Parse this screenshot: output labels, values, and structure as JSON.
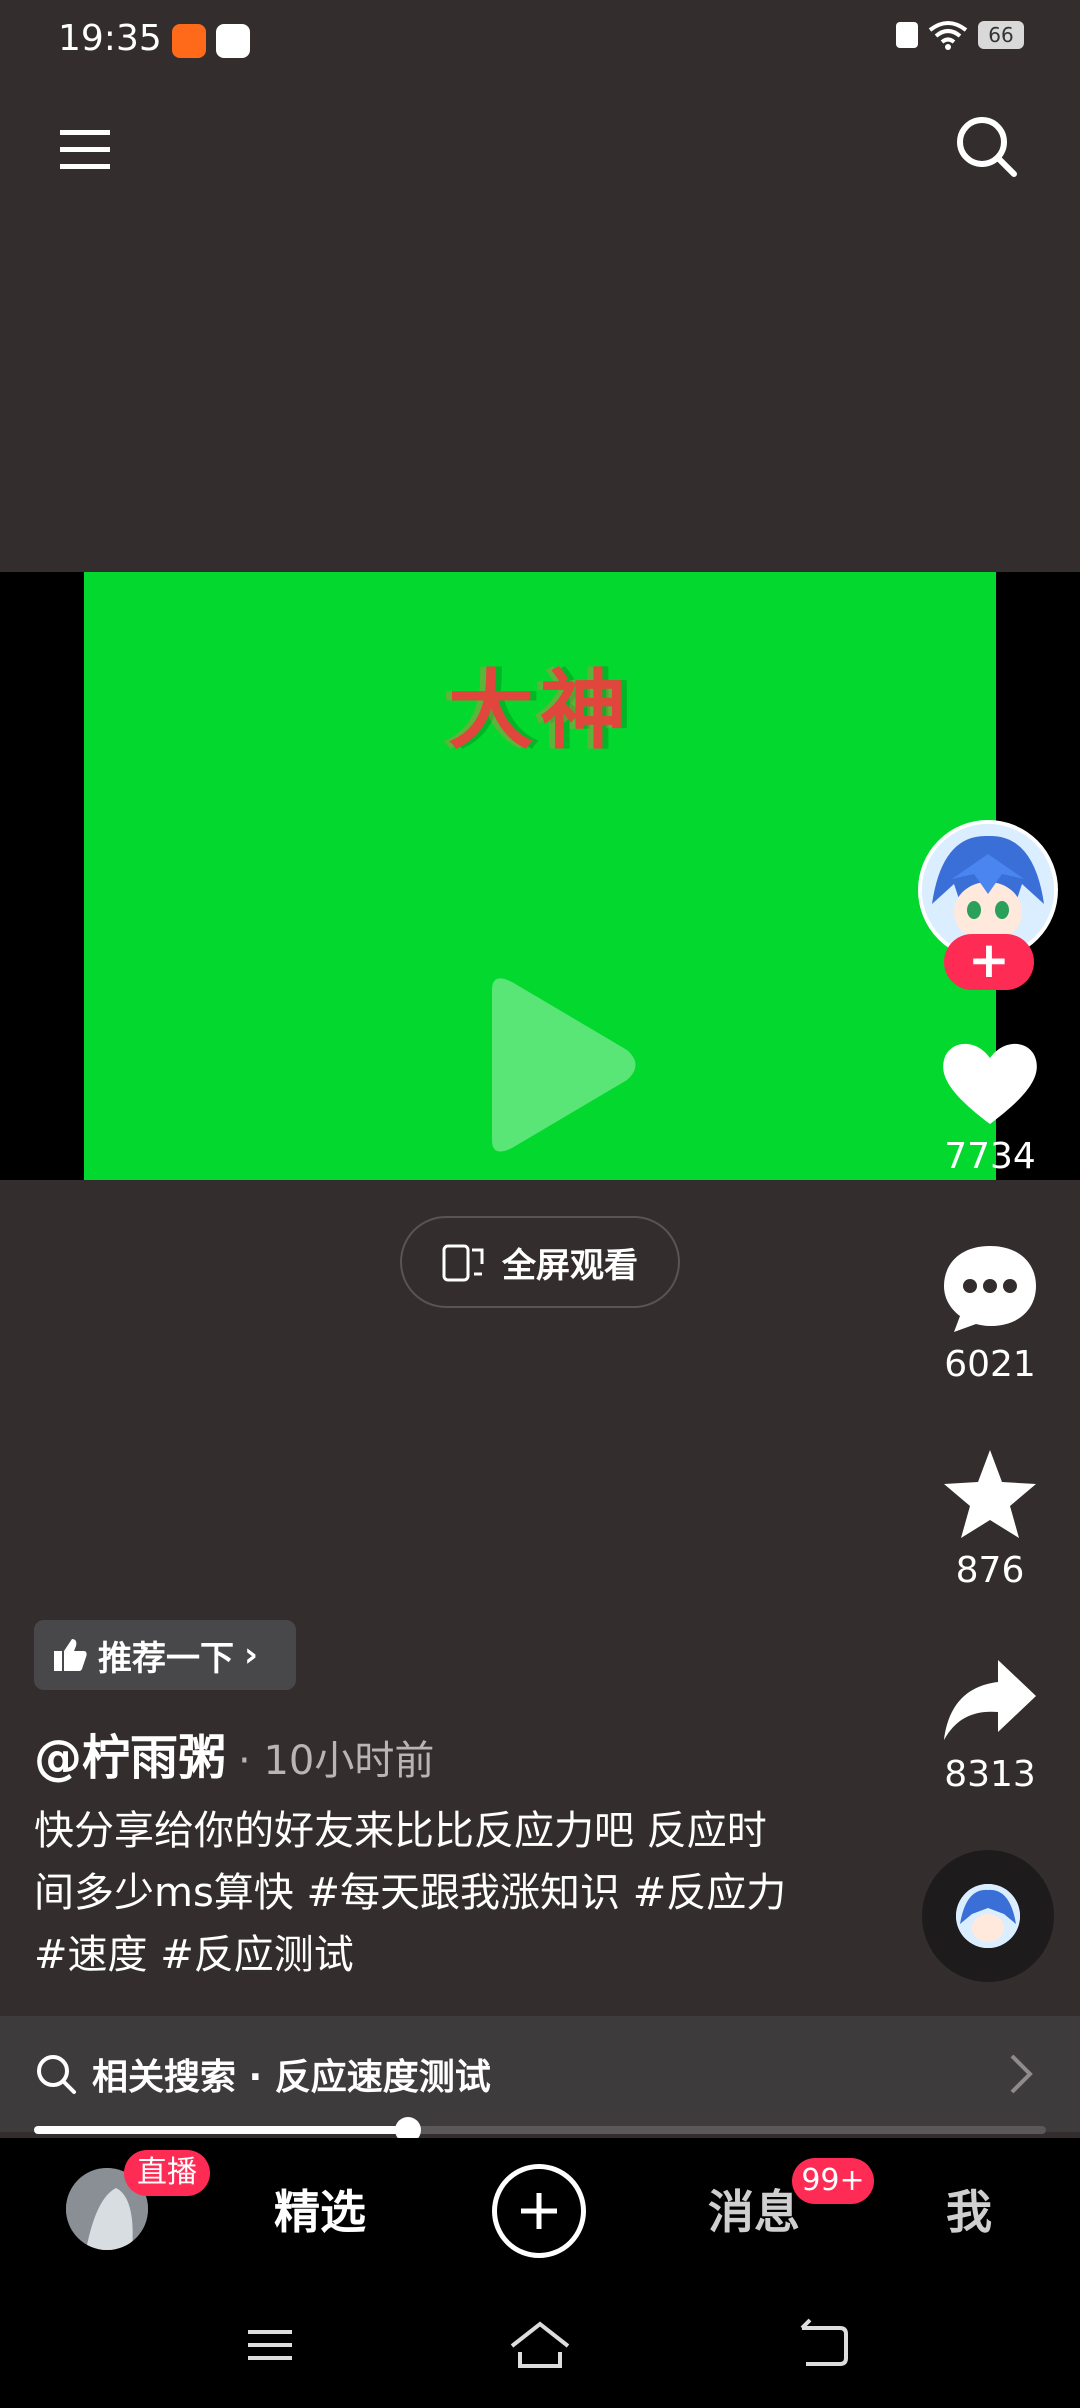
{
  "status_bar": {
    "time": "19:35",
    "battery": "66"
  },
  "video": {
    "overlay_text": "大神"
  },
  "fullscreen": {
    "label": "全屏观看"
  },
  "actions": {
    "likes": "7734",
    "comments": "6021",
    "favorites": "876",
    "shares": "8313"
  },
  "recommend": {
    "label": "推荐一下"
  },
  "post": {
    "author": "@柠雨粥",
    "time": "· 10小时前",
    "caption": "快分享给你的好友来比比反应力吧 反应时间多少ms算快 #每天跟我涨知识 #反应力 #速度 #反应测试"
  },
  "related_search": {
    "text": "相关搜索 · 反应速度测试"
  },
  "progress": {
    "fraction": 0.37
  },
  "bottom_nav": {
    "live_badge": "直播",
    "featured": "精选",
    "messages": "消息",
    "messages_badge": "99+",
    "me": "我"
  },
  "colors": {
    "accent": "#fe2c55",
    "background": "#342d2e",
    "video_green": "#02d82e"
  }
}
